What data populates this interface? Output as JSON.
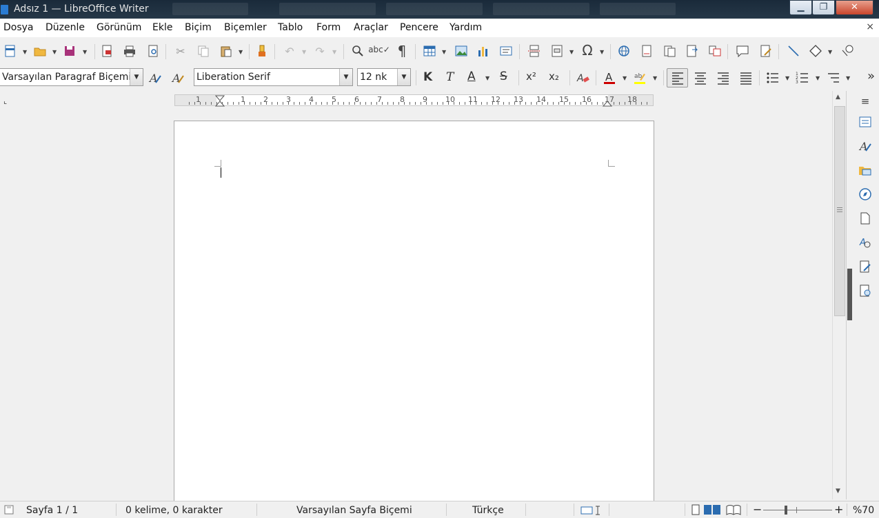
{
  "window": {
    "title": "Adsız 1 — LibreOffice Writer",
    "minimize_icon": "minimize-icon",
    "maximize_icon": "maximize-icon",
    "close_icon": "close-icon"
  },
  "menu": {
    "items": [
      "Dosya",
      "Düzenle",
      "Görünüm",
      "Ekle",
      "Biçim",
      "Biçemler",
      "Tablo",
      "Form",
      "Araçlar",
      "Pencere",
      "Yardım"
    ],
    "close_glyph": "×"
  },
  "formatting": {
    "paragraph_style": "Varsayılan Paragraf Biçemi",
    "font_name": "Liberation Serif",
    "font_size": "12 nk",
    "bold_glyph": "K",
    "italic_glyph": "T",
    "underline_glyph": "A",
    "strike_glyph": "S",
    "superscript_glyph": "x²",
    "subscript_glyph": "x₂",
    "font_color": "#cc0000",
    "highlight_color": "#ffff00",
    "more_glyph": "»"
  },
  "ruler": {
    "numbers": [
      "1",
      "1",
      "2",
      "3",
      "4",
      "5",
      "6",
      "7",
      "8",
      "9",
      "10",
      "11",
      "12",
      "13",
      "14",
      "15",
      "16",
      "17",
      "18"
    ]
  },
  "status": {
    "page": "Sayfa 1 / 1",
    "words": "0 kelime, 0 karakter",
    "page_style": "Varsayılan Sayfa Biçemi",
    "language": "Türkçe",
    "zoom": "%70",
    "zoom_out": "−",
    "zoom_in": "+"
  },
  "accent_color": "#2b6cb0"
}
